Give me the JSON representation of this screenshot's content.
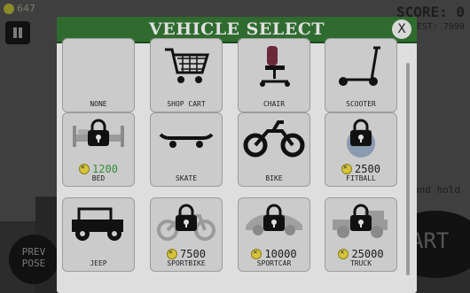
{
  "hud": {
    "coins": "647",
    "score": "SCORE: 0",
    "best": "BEST: 7999",
    "hint": "and hold",
    "prev_pose": "PREV\nPOSE",
    "start": "ART"
  },
  "dialog": {
    "title": "VEHICLE SELECT",
    "close_label": "X",
    "colors": {
      "header": "#2f6b2f",
      "coin": "#d4c43a",
      "owned_price": "#3a8a3a"
    }
  },
  "vehicles": [
    {
      "label": "NONE",
      "icon": "none-icon",
      "locked": false
    },
    {
      "label": "SHOP CART",
      "icon": "shopping-cart-icon",
      "locked": false
    },
    {
      "label": "CHAIR",
      "icon": "office-chair-icon",
      "locked": false
    },
    {
      "label": "SCOOTER",
      "icon": "scooter-icon",
      "locked": false
    },
    {
      "label": "BED",
      "icon": "bed-icon",
      "locked": true,
      "price": "1200"
    },
    {
      "label": "SKATE",
      "icon": "skateboard-icon",
      "locked": false
    },
    {
      "label": "BIKE",
      "icon": "motorbike-icon",
      "locked": false
    },
    {
      "label": "FITBALL",
      "icon": "fitball-icon",
      "locked": true,
      "price": "2500"
    },
    {
      "label": "JEEP",
      "icon": "jeep-icon",
      "locked": false
    },
    {
      "label": "SPORTBIKE",
      "icon": "sportbike-icon",
      "locked": true,
      "price": "7500"
    },
    {
      "label": "SPORTCAR",
      "icon": "sportcar-icon",
      "locked": true,
      "price": "10000"
    },
    {
      "label": "TRUCK",
      "icon": "truck-icon",
      "locked": true,
      "price": "25000"
    }
  ]
}
